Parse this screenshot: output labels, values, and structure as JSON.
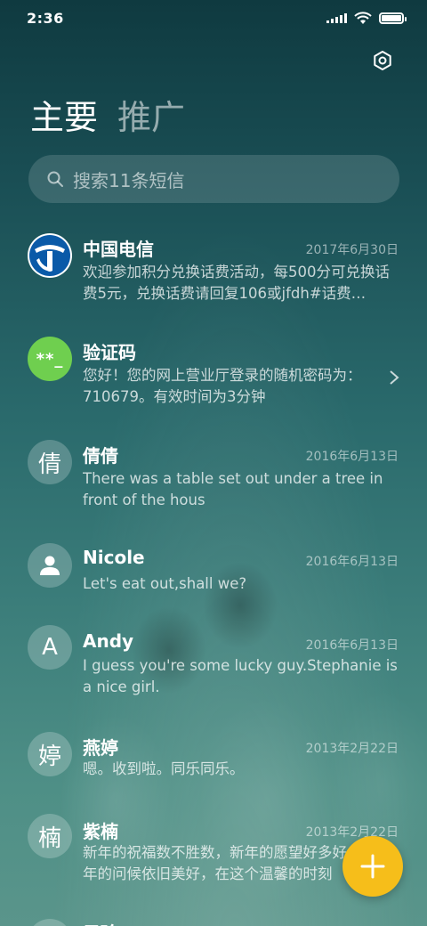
{
  "status_bar": {
    "time": "2:36"
  },
  "tabs": [
    {
      "label": "主要",
      "active": true
    },
    {
      "label": "推广",
      "active": false
    }
  ],
  "search": {
    "placeholder": "搜索11条短信"
  },
  "conversations": [
    {
      "name": "中国电信",
      "date": "2017年6月30日",
      "preview": "欢迎参加积分兑换话费活动，每500分可兑换话费5元，兑换话费请回复106或jfdh#话费…",
      "avatar_type": "telecom-logo"
    },
    {
      "name": "验证码",
      "date": "",
      "preview": "您好！您的网上营业厅登录的随机密码为：710679。有效时间为3分钟",
      "avatar_type": "code",
      "avatar_text": "**_"
    },
    {
      "name": "倩倩",
      "date": "2016年6月13日",
      "preview": "There was a table set out under a tree in front of the hous",
      "avatar_type": "letter",
      "avatar_text": "倩"
    },
    {
      "name": "Nicole",
      "date": "2016年6月13日",
      "preview": "Let's eat out,shall we?",
      "avatar_type": "person-icon"
    },
    {
      "name": "Andy",
      "date": "2016年6月13日",
      "preview": "I guess you're some lucky guy.Stephanie is a nice girl.",
      "avatar_type": "letter",
      "avatar_text": "A"
    },
    {
      "name": "燕婷",
      "date": "2013年2月22日",
      "preview": "嗯。收到啦。同乐同乐。",
      "avatar_type": "letter",
      "avatar_text": "婷"
    },
    {
      "name": "紫楠",
      "date": "2013年2月22日",
      "preview": "新年的祝福数不胜数，新年的愿望好多好多，新年的问候依旧美好，在这个温馨的时刻",
      "avatar_type": "letter",
      "avatar_text": "楠"
    },
    {
      "name": "子玲",
      "date": "",
      "preview": "",
      "avatar_type": "letter",
      "avatar_text": ""
    }
  ],
  "icons": {
    "settings": "gear-icon",
    "search": "search-icon",
    "fab": "plus-icon",
    "chevron": "chevron-right-icon"
  },
  "colors": {
    "fab": "#f6be1a",
    "code_avatar": "#6fcf4f",
    "telecom_blue": "#0a5aa8"
  }
}
